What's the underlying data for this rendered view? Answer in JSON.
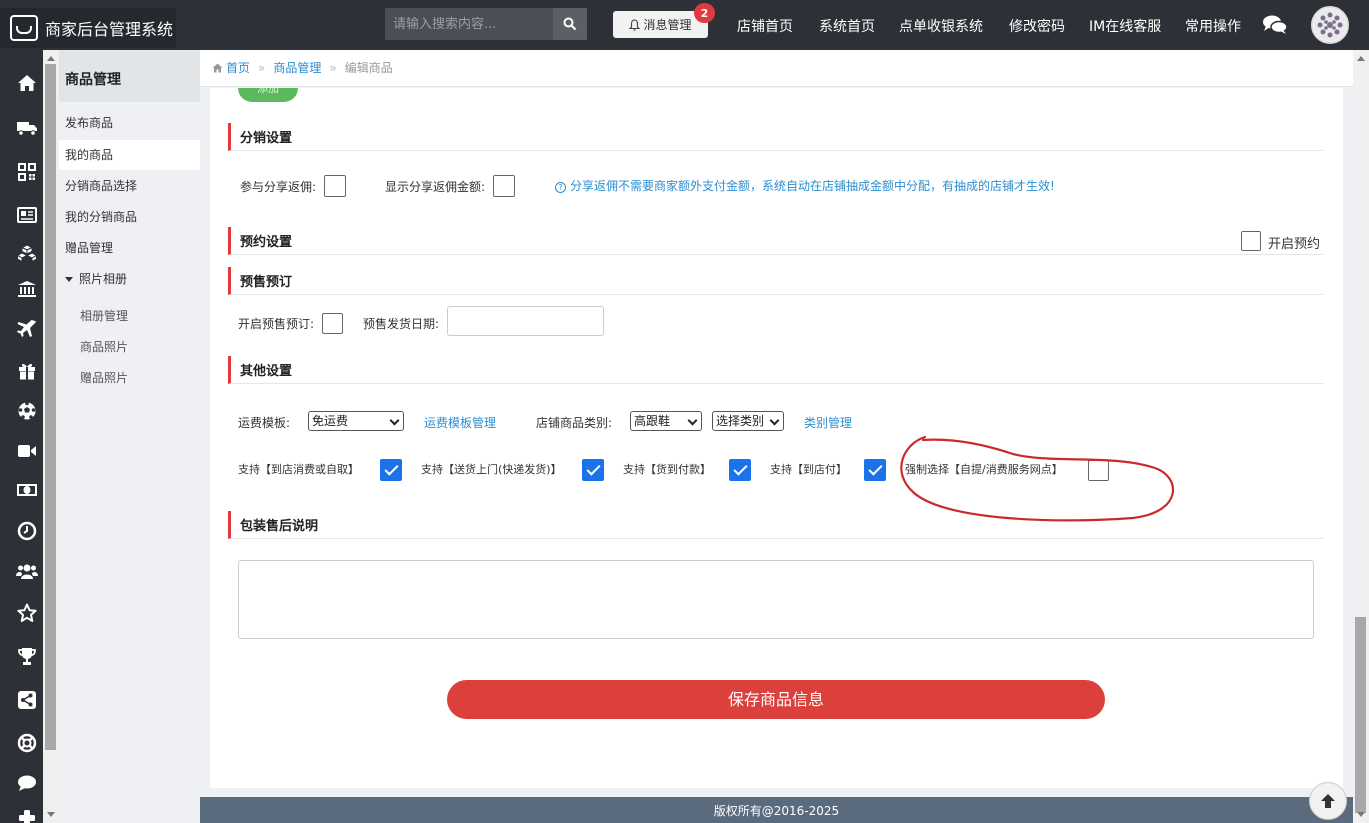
{
  "app": {
    "title": "商家后台管理系统"
  },
  "search": {
    "placeholder": "请输入搜索内容..."
  },
  "messages": {
    "label": "消息管理",
    "count": "2"
  },
  "topnav": [
    "店铺首页",
    "系统首页",
    "点单收银系统",
    "修改密码",
    "IM在线客服",
    "常用操作"
  ],
  "rail_icons": [
    "home-icon",
    "truck-icon",
    "qrcode-icon",
    "newspaper-icon",
    "cubes-icon",
    "bank-icon",
    "plane-icon",
    "gift-icon",
    "soccer-icon",
    "video-icon",
    "money-icon",
    "clock-icon",
    "users-icon",
    "star-icon",
    "trophy-icon",
    "share-icon",
    "lifebuoy-icon",
    "comment-icon",
    "plus-icon"
  ],
  "sidebar": {
    "title": "商品管理",
    "items": [
      "发布商品",
      "我的商品",
      "分销商品选择",
      "我的分销商品",
      "赠品管理"
    ],
    "group": "照片相册",
    "sub_items": [
      "相册管理",
      "商品照片",
      "赠品照片"
    ]
  },
  "breadcrumb": {
    "home": "首页",
    "section": "商品管理",
    "current": "编辑商品",
    "separator": "»"
  },
  "top_button_label": "添加",
  "distribution": {
    "title": "分销设置",
    "share_label": "参与分享返佣:",
    "show_amount_label": "显示分享返佣金额:",
    "hint": "分享返佣不需要商家额外支付金额，系统自动在店铺抽成金额中分配，有抽成的店铺才生效!"
  },
  "reservation": {
    "title": "预约设置",
    "enable_label": "开启预约"
  },
  "presale": {
    "title": "预售预订",
    "enable_label": "开启预售预订:",
    "date_label": "预售发货日期:"
  },
  "other": {
    "title": "其他设置",
    "shipping_label": "运费模板:",
    "shipping_value": "免运费",
    "shipping_link": "运费模板管理",
    "category_label": "店铺商品类别:",
    "category_value": "高跟鞋",
    "category_select": "选择类别",
    "category_link": "类别管理",
    "options": [
      {
        "label": "支持【到店消费或自取】",
        "checked": true
      },
      {
        "label": "支持【送货上门(快递发货)】",
        "checked": true
      },
      {
        "label": "支持【货到付款】",
        "checked": true
      },
      {
        "label": "支持【到店付】",
        "checked": true
      },
      {
        "label": "强制选择【自提/消费服务网点】",
        "checked": false
      }
    ]
  },
  "packaging": {
    "title": "包装售后说明"
  },
  "save_label": "保存商品信息",
  "footer": "版权所有@2016-2025",
  "colors": {
    "accent_red": "#dc403c",
    "link_blue": "#2b8fd0",
    "topbar": "#2d3037",
    "footer": "#5b6b7e",
    "annotation": "#cc2a2a"
  }
}
